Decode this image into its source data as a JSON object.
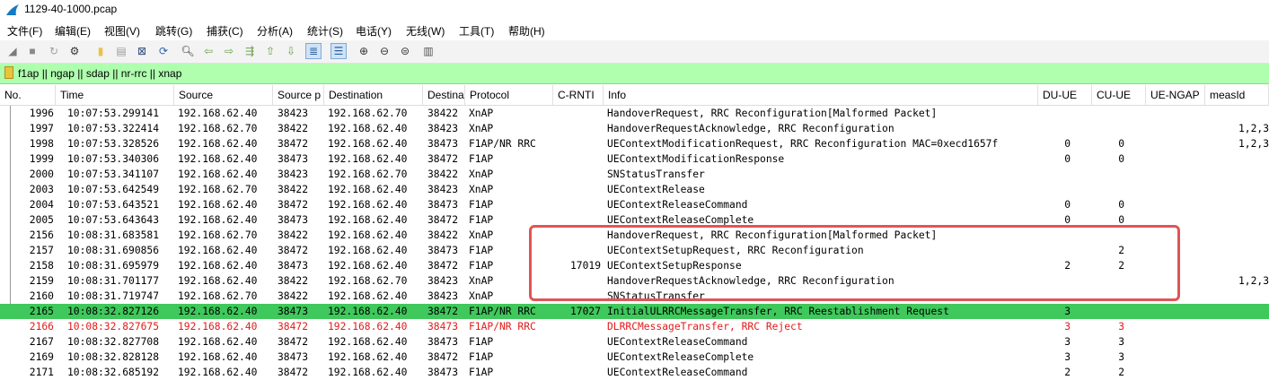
{
  "window": {
    "title": "1129-40-1000.pcap"
  },
  "menu": [
    {
      "label": "文件(F)"
    },
    {
      "label": "编辑(E)"
    },
    {
      "label": "视图(V)"
    },
    {
      "label": "跳转(G)"
    },
    {
      "label": "捕获(C)"
    },
    {
      "label": "分析(A)"
    },
    {
      "label": "统计(S)"
    },
    {
      "label": "电话(Y)"
    },
    {
      "label": "无线(W)"
    },
    {
      "label": "工具(T)"
    },
    {
      "label": "帮助(H)"
    }
  ],
  "toolbar": [
    {
      "icon": "shark-fin-start-icon",
      "glyph": "◢",
      "color": "#7b7b7b"
    },
    {
      "icon": "stop-icon",
      "glyph": "■",
      "color": "#8a8a8a"
    },
    {
      "icon": "restart-icon",
      "glyph": "↻",
      "color": "#a0a0a0"
    },
    {
      "icon": "capture-options-icon",
      "glyph": "⚙",
      "color": "#333333"
    },
    {
      "icon": "open-file-icon",
      "glyph": "▮",
      "color": "#e8c24a"
    },
    {
      "icon": "save-file-icon",
      "glyph": "▤",
      "color": "#9a9a9a"
    },
    {
      "icon": "close-file-icon",
      "glyph": "⊠",
      "color": "#304a7a"
    },
    {
      "icon": "reload-icon",
      "glyph": "⟳",
      "color": "#2f64b1"
    },
    {
      "icon": "find-packet-icon",
      "glyph": "🔍︎",
      "color": "#333333"
    },
    {
      "icon": "go-back-icon",
      "glyph": "⇦",
      "color": "#6aa24a"
    },
    {
      "icon": "go-forward-icon",
      "glyph": "⇨",
      "color": "#6aa24a"
    },
    {
      "icon": "go-to-packet-icon",
      "glyph": "⇶",
      "color": "#6aa24a"
    },
    {
      "icon": "first-packet-icon",
      "glyph": "⇧",
      "color": "#6aa24a"
    },
    {
      "icon": "last-packet-icon",
      "glyph": "⇩",
      "color": "#6aa24a"
    },
    {
      "icon": "auto-scroll-icon",
      "glyph": "≣",
      "color": "#2f5fa0",
      "selected": true
    },
    {
      "icon": "colorize-icon",
      "glyph": "☰",
      "color": "#2f5fa0",
      "selected": true
    },
    {
      "icon": "zoom-in-icon",
      "glyph": "⊕",
      "color": "#333333"
    },
    {
      "icon": "zoom-out-icon",
      "glyph": "⊖",
      "color": "#333333"
    },
    {
      "icon": "zoom-normal-icon",
      "glyph": "⊜",
      "color": "#333333"
    },
    {
      "icon": "resize-columns-icon",
      "glyph": "▥",
      "color": "#555555"
    }
  ],
  "filter": {
    "value": "f1ap || ngap || sdap || nr-rrc || xnap"
  },
  "columns": [
    "No.",
    "Time",
    "Source",
    "Source p",
    "Destination",
    "Destina",
    "Protocol",
    "C-RNTI",
    "Info",
    "DU-UE",
    "CU-UE",
    "UE-NGAP",
    "measId"
  ],
  "packets": [
    {
      "no": "1996",
      "time": "10:07:53.299141",
      "src": "192.168.62.40",
      "sport": "38423",
      "dst": "192.168.62.70",
      "dport": "38422",
      "proto": "XnAP",
      "crnti": "",
      "info": "HandoverRequest, RRC Reconfiguration[Malformed Packet]",
      "duue": "",
      "cuue": "",
      "uengap": "",
      "measid": ""
    },
    {
      "no": "1997",
      "time": "10:07:53.322414",
      "src": "192.168.62.70",
      "sport": "38422",
      "dst": "192.168.62.40",
      "dport": "38423",
      "proto": "XnAP",
      "crnti": "",
      "info": "HandoverRequestAcknowledge, RRC Reconfiguration",
      "duue": "",
      "cuue": "",
      "uengap": "",
      "measid": "1,2,3"
    },
    {
      "no": "1998",
      "time": "10:07:53.328526",
      "src": "192.168.62.40",
      "sport": "38472",
      "dst": "192.168.62.40",
      "dport": "38473",
      "proto": "F1AP/NR RRC",
      "crnti": "",
      "info": "UEContextModificationRequest, RRC Reconfiguration MAC=0xecd1657f",
      "duue": "0",
      "cuue": "0",
      "uengap": "",
      "measid": "1,2,3"
    },
    {
      "no": "1999",
      "time": "10:07:53.340306",
      "src": "192.168.62.40",
      "sport": "38473",
      "dst": "192.168.62.40",
      "dport": "38472",
      "proto": "F1AP",
      "crnti": "",
      "info": "UEContextModificationResponse",
      "duue": "0",
      "cuue": "0",
      "uengap": "",
      "measid": ""
    },
    {
      "no": "2000",
      "time": "10:07:53.341107",
      "src": "192.168.62.40",
      "sport": "38423",
      "dst": "192.168.62.70",
      "dport": "38422",
      "proto": "XnAP",
      "crnti": "",
      "info": "SNStatusTransfer",
      "duue": "",
      "cuue": "",
      "uengap": "",
      "measid": ""
    },
    {
      "no": "2003",
      "time": "10:07:53.642549",
      "src": "192.168.62.70",
      "sport": "38422",
      "dst": "192.168.62.40",
      "dport": "38423",
      "proto": "XnAP",
      "crnti": "",
      "info": "UEContextRelease",
      "duue": "",
      "cuue": "",
      "uengap": "",
      "measid": ""
    },
    {
      "no": "2004",
      "time": "10:07:53.643521",
      "src": "192.168.62.40",
      "sport": "38472",
      "dst": "192.168.62.40",
      "dport": "38473",
      "proto": "F1AP",
      "crnti": "",
      "info": "UEContextReleaseCommand",
      "duue": "0",
      "cuue": "0",
      "uengap": "",
      "measid": ""
    },
    {
      "no": "2005",
      "time": "10:07:53.643643",
      "src": "192.168.62.40",
      "sport": "38473",
      "dst": "192.168.62.40",
      "dport": "38472",
      "proto": "F1AP",
      "crnti": "",
      "info": "UEContextReleaseComplete",
      "duue": "0",
      "cuue": "0",
      "uengap": "",
      "measid": ""
    },
    {
      "no": "2156",
      "time": "10:08:31.683581",
      "src": "192.168.62.70",
      "sport": "38422",
      "dst": "192.168.62.40",
      "dport": "38422",
      "proto": "XnAP",
      "crnti": "",
      "info": "HandoverRequest, RRC Reconfiguration[Malformed Packet]",
      "duue": "",
      "cuue": "",
      "uengap": "",
      "measid": ""
    },
    {
      "no": "2157",
      "time": "10:08:31.690856",
      "src": "192.168.62.40",
      "sport": "38472",
      "dst": "192.168.62.40",
      "dport": "38473",
      "proto": "F1AP",
      "crnti": "",
      "info": "UEContextSetupRequest, RRC Reconfiguration",
      "duue": "",
      "cuue": "2",
      "uengap": "",
      "measid": ""
    },
    {
      "no": "2158",
      "time": "10:08:31.695979",
      "src": "192.168.62.40",
      "sport": "38473",
      "dst": "192.168.62.40",
      "dport": "38472",
      "proto": "F1AP",
      "crnti": "17019",
      "info": "UEContextSetupResponse",
      "duue": "2",
      "cuue": "2",
      "uengap": "",
      "measid": ""
    },
    {
      "no": "2159",
      "time": "10:08:31.701177",
      "src": "192.168.62.40",
      "sport": "38422",
      "dst": "192.168.62.70",
      "dport": "38423",
      "proto": "XnAP",
      "crnti": "",
      "info": "HandoverRequestAcknowledge, RRC Reconfiguration",
      "duue": "",
      "cuue": "",
      "uengap": "",
      "measid": "1,2,3"
    },
    {
      "no": "2160",
      "time": "10:08:31.719747",
      "src": "192.168.62.70",
      "sport": "38422",
      "dst": "192.168.62.40",
      "dport": "38423",
      "proto": "XnAP",
      "crnti": "",
      "info": "SNStatusTransfer",
      "duue": "",
      "cuue": "",
      "uengap": "",
      "measid": ""
    },
    {
      "no": "2165",
      "time": "10:08:32.827126",
      "src": "192.168.62.40",
      "sport": "38473",
      "dst": "192.168.62.40",
      "dport": "38472",
      "proto": "F1AP/NR RRC",
      "crnti": "17027",
      "info": "InitialULRRCMessageTransfer, RRC Reestablishment Request",
      "duue": "3",
      "cuue": "",
      "uengap": "",
      "measid": "",
      "style": "green"
    },
    {
      "no": "2166",
      "time": "10:08:32.827675",
      "src": "192.168.62.40",
      "sport": "38472",
      "dst": "192.168.62.40",
      "dport": "38473",
      "proto": "F1AP/NR RRC",
      "crnti": "",
      "info": "DLRRCMessageTransfer, RRC Reject",
      "duue": "3",
      "cuue": "3",
      "uengap": "",
      "measid": "",
      "style": "red"
    },
    {
      "no": "2167",
      "time": "10:08:32.827708",
      "src": "192.168.62.40",
      "sport": "38472",
      "dst": "192.168.62.40",
      "dport": "38473",
      "proto": "F1AP",
      "crnti": "",
      "info": "UEContextReleaseCommand",
      "duue": "3",
      "cuue": "3",
      "uengap": "",
      "measid": ""
    },
    {
      "no": "2169",
      "time": "10:08:32.828128",
      "src": "192.168.62.40",
      "sport": "38473",
      "dst": "192.168.62.40",
      "dport": "38472",
      "proto": "F1AP",
      "crnti": "",
      "info": "UEContextReleaseComplete",
      "duue": "3",
      "cuue": "3",
      "uengap": "",
      "measid": ""
    },
    {
      "no": "2171",
      "time": "10:08:32.685192",
      "src": "192.168.62.40",
      "sport": "38472",
      "dst": "192.168.62.40",
      "dport": "38473",
      "proto": "F1AP",
      "crnti": "",
      "info": "UEContextReleaseCommand",
      "duue": "2",
      "cuue": "2",
      "uengap": "",
      "measid": ""
    }
  ]
}
